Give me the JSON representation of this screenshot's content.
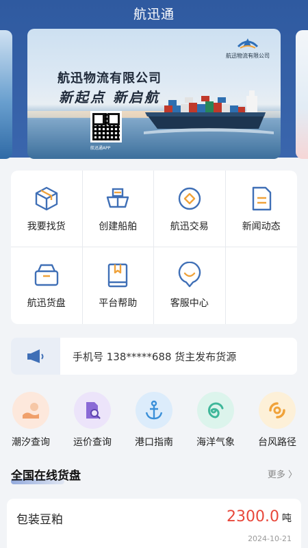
{
  "app": {
    "title": "航迅通"
  },
  "banner": {
    "company": "航迅物流有限公司",
    "slogan": "新起点  新启航",
    "logo_text": "航迅物流有限公司",
    "qr_caption": "航迅通APP"
  },
  "menu": [
    {
      "label": "我要找货",
      "icon": "cube-icon"
    },
    {
      "label": "创建船舶",
      "icon": "ship-icon"
    },
    {
      "label": "航迅交易",
      "icon": "diamond-coin-icon"
    },
    {
      "label": "新闻动态",
      "icon": "document-icon"
    },
    {
      "label": "航迅货盘",
      "icon": "tray-box-icon"
    },
    {
      "label": "平台帮助",
      "icon": "book-icon"
    },
    {
      "label": "客服中心",
      "icon": "chat-smile-icon"
    }
  ],
  "notice": {
    "text": "手机号 138*****688 货主发布货源",
    "icon": "megaphone-icon"
  },
  "quick_links": [
    {
      "label": "潮汐查询",
      "icon": "tide-icon",
      "color": "#f0a06b",
      "bg": "#fde8dc"
    },
    {
      "label": "运价查询",
      "icon": "price-search-icon",
      "color": "#8a6ad6",
      "bg": "#ece4fa"
    },
    {
      "label": "港口指南",
      "icon": "anchor-icon",
      "color": "#3a8fd8",
      "bg": "#dcecfb"
    },
    {
      "label": "海洋气象",
      "icon": "wave-swirl-icon",
      "color": "#3fb79a",
      "bg": "#dcf4ec"
    },
    {
      "label": "台风路径",
      "icon": "typhoon-icon",
      "color": "#f0a23a",
      "bg": "#fdf0d8"
    }
  ],
  "section": {
    "title": "全国在线货盘",
    "more": "更多"
  },
  "cargo": {
    "name": "包装豆粕",
    "price": "2300.0",
    "unit": "吨",
    "date": "2024-10-21"
  },
  "colors": {
    "primary": "#2f5aa0",
    "accent_price": "#e8473a",
    "icon_blue": "#3f6fb6",
    "icon_orange": "#f0a23a"
  }
}
